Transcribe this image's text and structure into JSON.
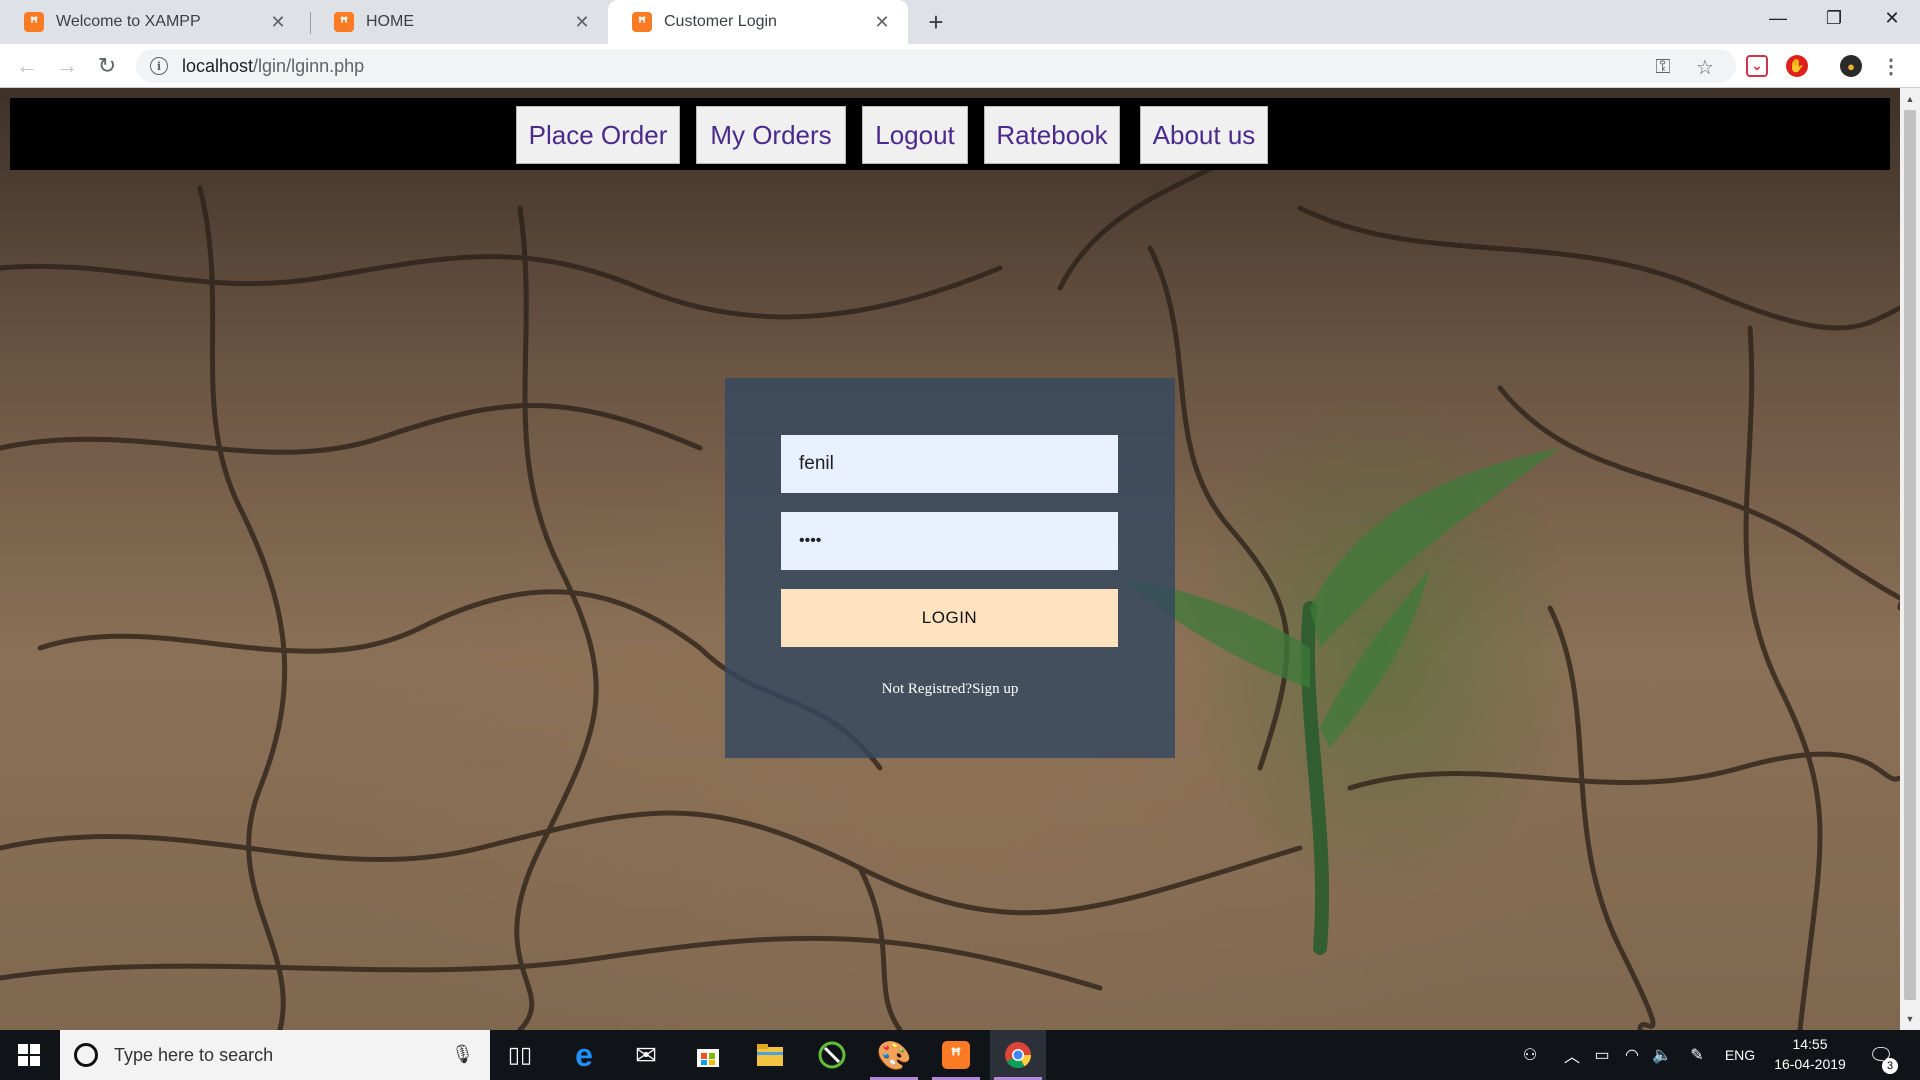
{
  "browser": {
    "tabs": [
      {
        "title": "Welcome to XAMPP",
        "favicon": "xampp-icon"
      },
      {
        "title": "HOME",
        "favicon": "xampp-icon"
      },
      {
        "title": "Customer Login",
        "favicon": "xampp-icon",
        "active": true
      }
    ],
    "url_host": "localhost",
    "url_path": "/lgin/lginn.php"
  },
  "nav": {
    "items": [
      "Place Order",
      "My Orders",
      "Logout",
      "Ratebook",
      "About us"
    ]
  },
  "login": {
    "username_value": "fenil",
    "password_mask": "••••",
    "login_label": "LOGIN",
    "not_registered_text": "Not Registred?",
    "signup_link": "Sign up"
  },
  "taskbar": {
    "search_placeholder": "Type here to search",
    "language": "ENG",
    "time": "14:55",
    "date": "16-04-2019",
    "notification_count": "3"
  },
  "colors": {
    "navbar": "#000000",
    "nav_text": "#4b2a8c",
    "login_panel": "#34485f",
    "input_bg": "#e8f0fe",
    "login_button": "#ffe3c0"
  }
}
